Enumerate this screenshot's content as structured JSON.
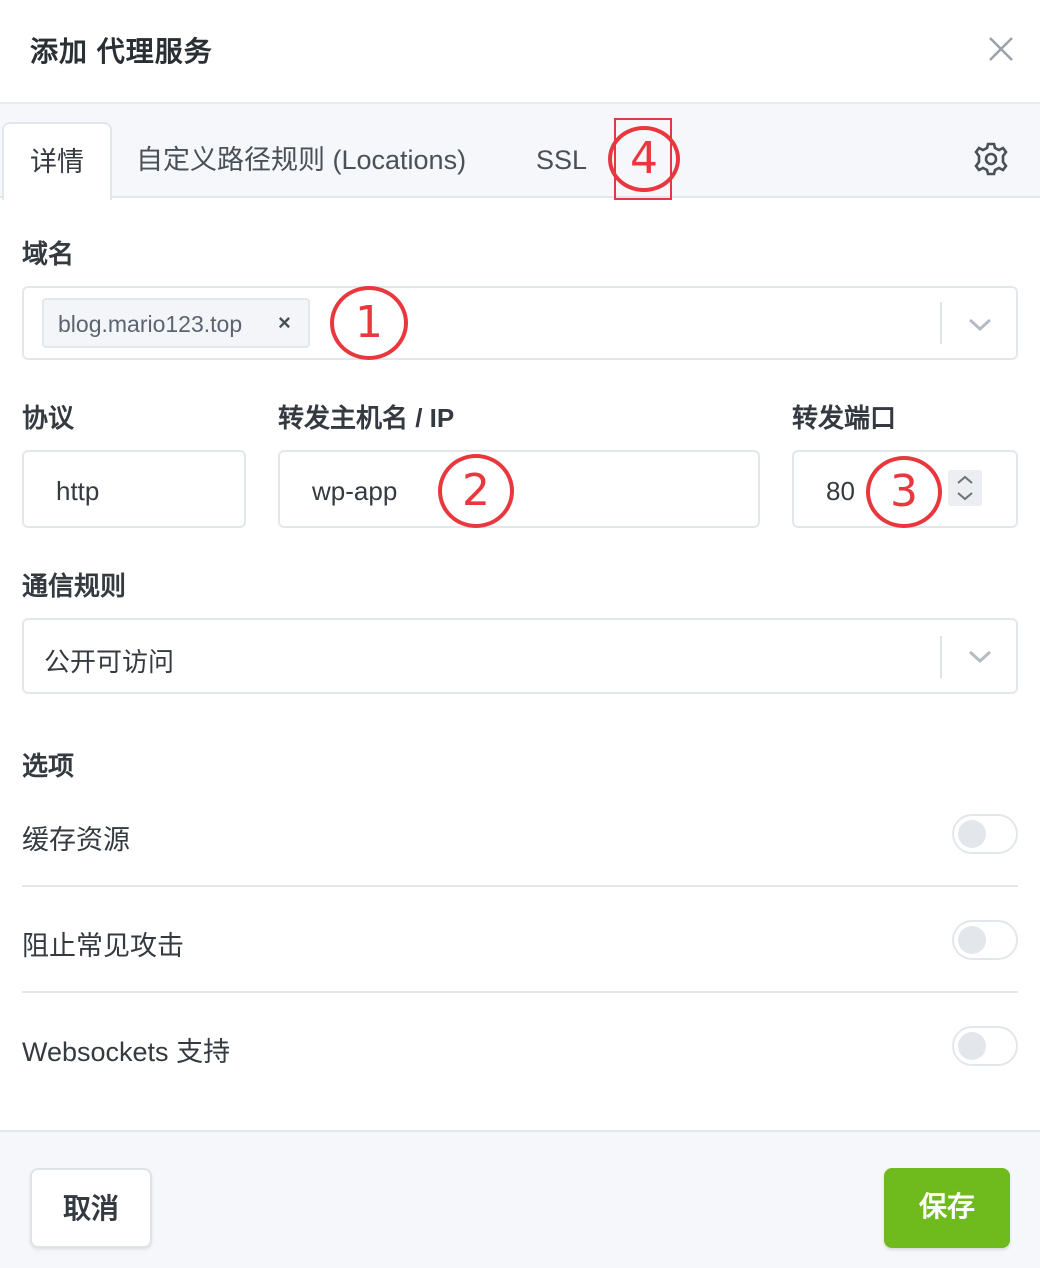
{
  "dialog": {
    "title": "添加 代理服务"
  },
  "tabs": [
    {
      "label": "详情",
      "active": true
    },
    {
      "label": "自定义路径规则 (Locations)",
      "active": false
    },
    {
      "label": "SSL",
      "active": false
    }
  ],
  "icons": {
    "close": "close-icon",
    "settings": "gear-icon",
    "dropdown": "chevron-down-icon"
  },
  "form": {
    "domain": {
      "label": "域名",
      "chips": [
        "blog.mario123.top"
      ],
      "remove_symbol": "×"
    },
    "scheme": {
      "label": "协议",
      "value": "http"
    },
    "forward_host": {
      "label": "转发主机名 / IP",
      "value": "wp-app"
    },
    "forward_port": {
      "label": "转发端口",
      "value": "80"
    },
    "access_list": {
      "label": "通信规则",
      "value": "公开可访问"
    }
  },
  "options": {
    "heading": "选项",
    "items": [
      {
        "label": "缓存资源",
        "enabled": false
      },
      {
        "label": "阻止常见攻击",
        "enabled": false
      },
      {
        "label": "Websockets 支持",
        "enabled": false
      }
    ]
  },
  "annotations": [
    "1",
    "2",
    "3",
    "4"
  ],
  "footer": {
    "cancel_label": "取消",
    "save_label": "保存"
  },
  "colors": {
    "accent_save": "#6fba1c",
    "annotation_red": "#e8383d"
  }
}
